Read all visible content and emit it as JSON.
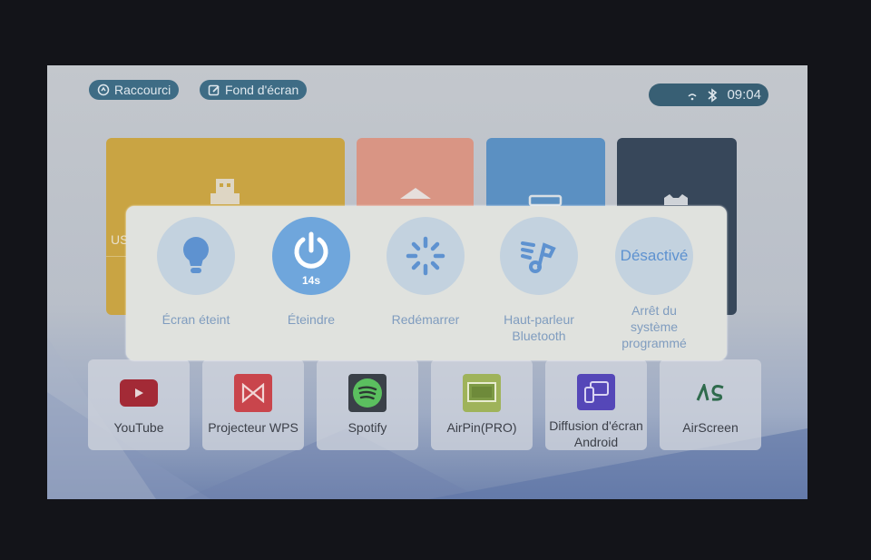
{
  "topbar": {
    "shortcut_label": "Raccourci",
    "wallpaper_label": "Fond d'écran",
    "time": "09:04",
    "icons": [
      "wifi-icon",
      "bluetooth-icon"
    ]
  },
  "background_tiles": [
    {
      "name": "usb",
      "partial_label": "US",
      "color": "#c9a443"
    },
    {
      "name": "home",
      "color": "#d99584"
    },
    {
      "name": "media",
      "color": "#5b90c2"
    },
    {
      "name": "settings",
      "color": "#37475a"
    }
  ],
  "power_dialog": {
    "options": [
      {
        "label": "Écran éteint",
        "icon": "lightbulb-icon"
      },
      {
        "label": "Éteindre",
        "icon": "power-icon",
        "countdown": "14s",
        "selected": true
      },
      {
        "label": "Redémarrer",
        "icon": "restart-spinner-icon"
      },
      {
        "label": "Haut-parleur Bluetooth",
        "icon": "bluetooth-speaker-music-icon"
      },
      {
        "label": "Arrêt du système programmé",
        "status": "Désactivé"
      }
    ]
  },
  "apps": [
    {
      "label": "YouTube",
      "icon": "youtube-icon",
      "color": "#a32a36"
    },
    {
      "label": "Projecteur WPS",
      "icon": "wps-projector-icon",
      "color": "#c9454c"
    },
    {
      "label": "Spotify",
      "icon": "spotify-icon",
      "color": "#3a4048"
    },
    {
      "label": "AirPin(PRO)",
      "icon": "airpin-icon",
      "color": "#9fb35a"
    },
    {
      "label": "Diffusion d'écran Android",
      "icon": "screen-cast-icon",
      "color": "#5547b8"
    },
    {
      "label": "AirScreen",
      "icon": "airscreen-icon",
      "color": "#2f6b4d"
    }
  ],
  "colors": {
    "accent": "#6fa6dc",
    "option_bg": "#c3d2df",
    "option_text": "#7f9cbf",
    "topbar_button": "#3e6c85"
  }
}
